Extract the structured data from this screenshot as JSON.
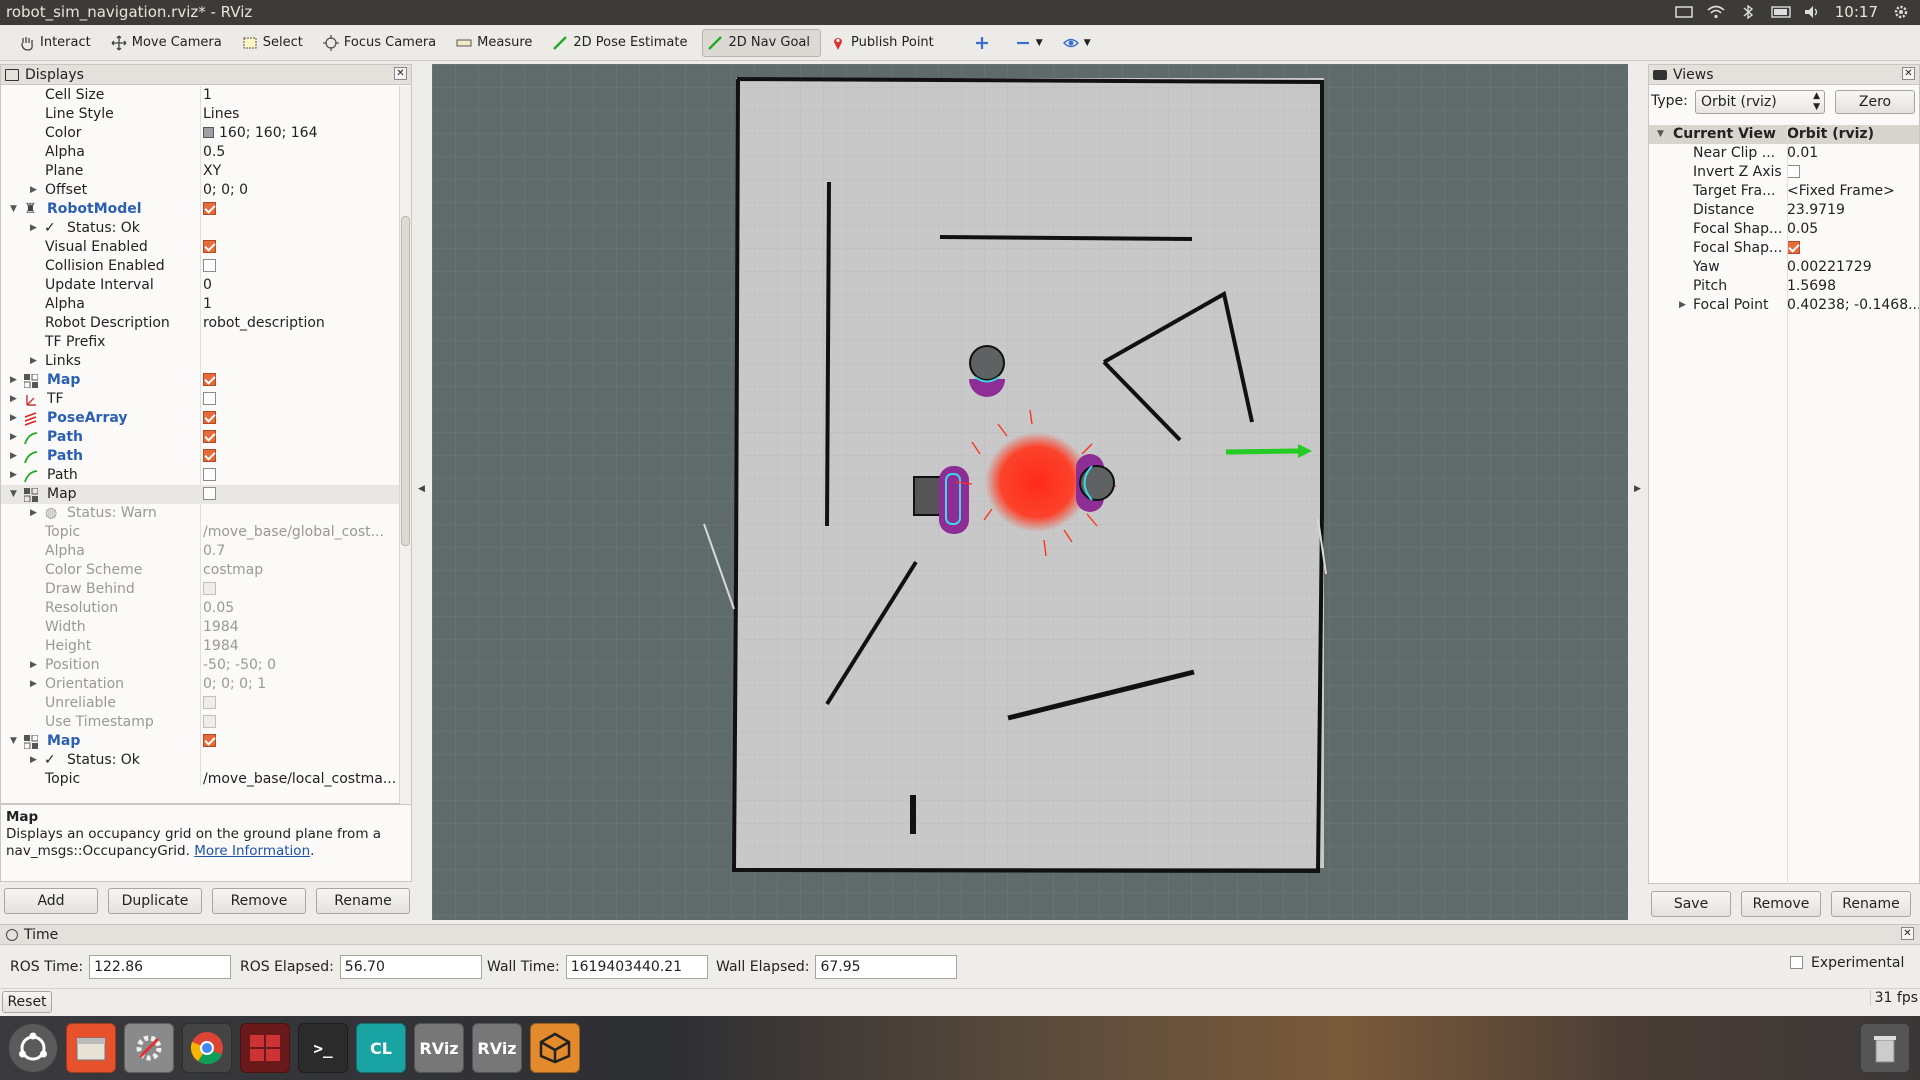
{
  "window": {
    "title": "robot_sim_navigation.rviz* - RViz"
  },
  "system": {
    "clock": "10:17"
  },
  "toolbar": {
    "tools": [
      {
        "label": "Interact",
        "icon": "hand-icon"
      },
      {
        "label": "Move Camera",
        "icon": "move-camera-icon"
      },
      {
        "label": "Select",
        "icon": "select-icon"
      },
      {
        "label": "Focus Camera",
        "icon": "focus-camera-icon"
      },
      {
        "label": "Measure",
        "icon": "measure-icon"
      },
      {
        "label": "2D Pose Estimate",
        "icon": "pose-estimate-icon"
      },
      {
        "label": "2D Nav Goal",
        "icon": "nav-goal-icon"
      },
      {
        "label": "Publish Point",
        "icon": "publish-point-icon"
      }
    ]
  },
  "displays": {
    "title": "Displays",
    "rows": [
      {
        "label": "Cell Size",
        "value": "1"
      },
      {
        "label": "Line Style",
        "value": "Lines"
      },
      {
        "label": "Color",
        "value": "160; 160; 164"
      },
      {
        "label": "Alpha",
        "value": "0.5"
      },
      {
        "label": "Plane",
        "value": "XY"
      },
      {
        "label": "Offset",
        "value": "0; 0; 0"
      },
      {
        "label": "RobotModel"
      },
      {
        "label": "Status: Ok"
      },
      {
        "label": "Visual Enabled"
      },
      {
        "label": "Collision Enabled"
      },
      {
        "label": "Update Interval",
        "value": "0"
      },
      {
        "label": "Alpha",
        "value": "1"
      },
      {
        "label": "Robot Description",
        "value": "robot_description"
      },
      {
        "label": "TF Prefix",
        "value": ""
      },
      {
        "label": "Links"
      },
      {
        "label": "Map"
      },
      {
        "label": "TF"
      },
      {
        "label": "PoseArray"
      },
      {
        "label": "Path"
      },
      {
        "label": "Path"
      },
      {
        "label": "Path"
      },
      {
        "label": "Map"
      },
      {
        "label": "Status: Warn"
      },
      {
        "label": "Topic",
        "value": "/move_base/global_cost..."
      },
      {
        "label": "Alpha",
        "value": "0.7"
      },
      {
        "label": "Color Scheme",
        "value": "costmap"
      },
      {
        "label": "Draw Behind"
      },
      {
        "label": "Resolution",
        "value": "0.05"
      },
      {
        "label": "Width",
        "value": "1984"
      },
      {
        "label": "Height",
        "value": "1984"
      },
      {
        "label": "Position",
        "value": "-50; -50; 0"
      },
      {
        "label": "Orientation",
        "value": "0; 0; 0; 1"
      },
      {
        "label": "Unreliable"
      },
      {
        "label": "Use Timestamp"
      },
      {
        "label": "Map"
      },
      {
        "label": "Status: Ok"
      },
      {
        "label": "Topic",
        "value": "/move_base/local_costma..."
      }
    ]
  },
  "description": {
    "heading": "Map",
    "text": "Displays an occupancy grid on the ground plane from a nav_msgs::OccupancyGrid.",
    "link": "More Information",
    "tail": "."
  },
  "display_buttons": {
    "add": "Add",
    "duplicate": "Duplicate",
    "remove": "Remove",
    "rename": "Rename"
  },
  "views": {
    "title": "Views",
    "type_label": "Type:",
    "type_value": "Orbit (rviz)",
    "zero": "Zero",
    "rows": [
      {
        "label": "Current View",
        "value": "Orbit (rviz)"
      },
      {
        "label": "Near Clip ...",
        "value": "0.01"
      },
      {
        "label": "Invert Z Axis",
        "value": ""
      },
      {
        "label": "Target Fra...",
        "value": "<Fixed Frame>"
      },
      {
        "label": "Distance",
        "value": "23.9719"
      },
      {
        "label": "Focal Shap...",
        "value": "0.05"
      },
      {
        "label": "Focal Shap...",
        "value": ""
      },
      {
        "label": "Yaw",
        "value": "0.00221729"
      },
      {
        "label": "Pitch",
        "value": "1.5698"
      },
      {
        "label": "Focal Point",
        "value": "0.40238; -0.1468..."
      }
    ],
    "save": "Save",
    "remove": "Remove",
    "rename": "Rename"
  },
  "time": {
    "title": "Time",
    "ros_time_label": "ROS Time:",
    "ros_time": "122.86",
    "ros_elapsed_label": "ROS Elapsed:",
    "ros_elapsed": "56.70",
    "wall_time_label": "Wall Time:",
    "wall_time": "1619403440.21",
    "wall_elapsed_label": "Wall Elapsed:",
    "wall_elapsed": "67.95",
    "experimental": "Experimental"
  },
  "status": {
    "reset": "Reset",
    "fps": "31 fps"
  },
  "dock": [
    "CL",
    "RViz",
    "RViz"
  ],
  "colors": {
    "accent_checkbox": "#e66a3a",
    "view_bg": "#5f6b6b",
    "map_floor": "#c8c8c8",
    "goal_arrow": "#22cc22",
    "pose_array": "#ff2a1a"
  }
}
